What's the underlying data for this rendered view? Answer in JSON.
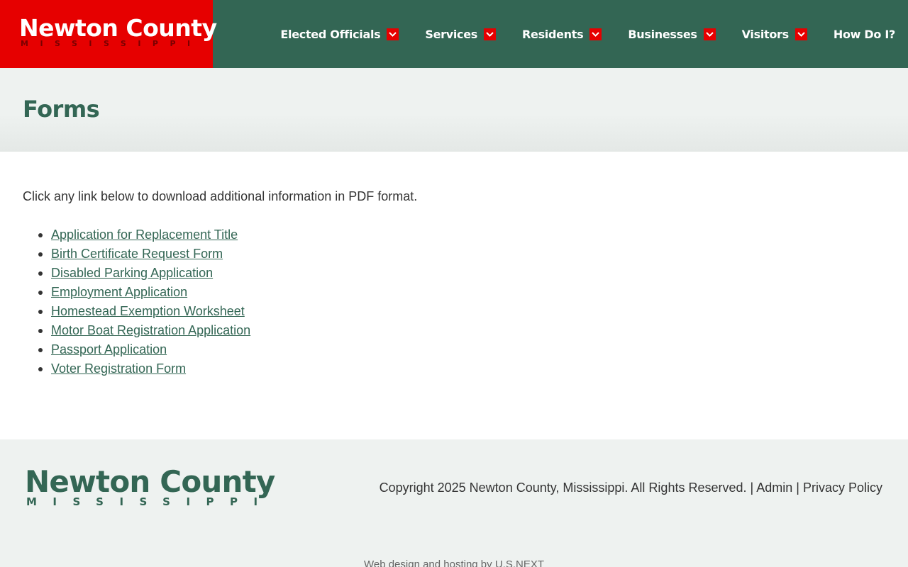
{
  "header": {
    "logo": {
      "title": "Newton County",
      "subtitle": "MISSISSIPPI"
    },
    "nav": [
      {
        "label": "Elected Officials",
        "has_dropdown": true
      },
      {
        "label": "Services",
        "has_dropdown": true
      },
      {
        "label": "Residents",
        "has_dropdown": true
      },
      {
        "label": "Businesses",
        "has_dropdown": true
      },
      {
        "label": "Visitors",
        "has_dropdown": true
      },
      {
        "label": "How Do I?",
        "has_dropdown": false
      }
    ],
    "icons": {
      "dropdown": "chevron-down-icon"
    }
  },
  "page": {
    "title": "Forms",
    "intro": "Click any link below to download additional information in PDF format.",
    "forms": [
      "Application for Replacement Title",
      "Birth Certificate Request Form",
      "Disabled Parking Application",
      "Employment Application",
      "Homestead Exemption Worksheet",
      "Motor Boat Registration Application",
      "Passport Application",
      "Voter Registration Form"
    ]
  },
  "footer": {
    "logo": {
      "title": "Newton County",
      "subtitle": "MISSISSIPPI"
    },
    "copyright": "Copyright 2025 Newton County, Mississippi. All Rights Reserved.",
    "separator": "|",
    "admin_label": "Admin",
    "privacy_label": "Privacy Policy",
    "credit_prefix": "Web design and hosting by",
    "credit_link": "U.S.NEXT"
  },
  "colors": {
    "brand_green": "#336654",
    "brand_red": "#e60000",
    "band_bg": "#eef2f0",
    "text": "#333333"
  }
}
